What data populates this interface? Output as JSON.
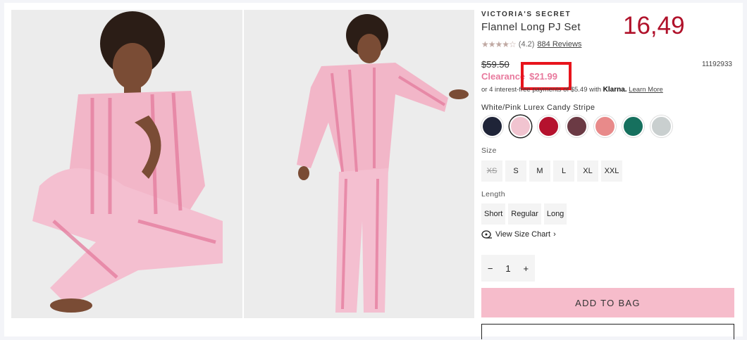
{
  "product": {
    "brand": "VICTORIA'S SECRET",
    "title": "Flannel Long PJ Set",
    "rating": "(4.2)",
    "stars": "★★★★☆",
    "reviews": "884 Reviews",
    "was_price": "$59.50",
    "sale_label": "Clearance",
    "sale_price": "$21.99",
    "sku": "11192933",
    "klarna_text": "or 4 interest-free payments of $5.49 with",
    "klarna_brand": "Klarna.",
    "klarna_link": "Learn More",
    "color_name": "White/Pink Lurex Candy Stripe"
  },
  "annotation": {
    "price": "16,49",
    "color": "#b0112a"
  },
  "swatches": [
    {
      "name": "navy-dots",
      "color": "#1f2438",
      "selected": false
    },
    {
      "name": "pink-stripe",
      "color": "#f1c4d0",
      "selected": true
    },
    {
      "name": "red-plaid",
      "color": "#b5122e",
      "selected": false
    },
    {
      "name": "burgundy-plaid",
      "color": "#6b3a44",
      "selected": false
    },
    {
      "name": "red-white-plaid",
      "color": "#e88a8a",
      "selected": false
    },
    {
      "name": "green-plaid",
      "color": "#16705e",
      "selected": false
    },
    {
      "name": "grey-stripe",
      "color": "#c9cfcf",
      "selected": false
    }
  ],
  "size": {
    "label": "Size",
    "options": [
      "XS",
      "S",
      "M",
      "L",
      "XL",
      "XXL"
    ]
  },
  "length": {
    "label": "Length",
    "options": [
      "Short",
      "Regular",
      "Long"
    ]
  },
  "size_chart": "View Size Chart",
  "quantity": {
    "minus": "−",
    "value": "1",
    "plus": "+"
  },
  "add_to_bag": "ADD TO BAG",
  "colors": {
    "clearance": "#e8799d",
    "add_to_bag_bg": "#f6bccb",
    "highlight_box": "#e8141c"
  }
}
